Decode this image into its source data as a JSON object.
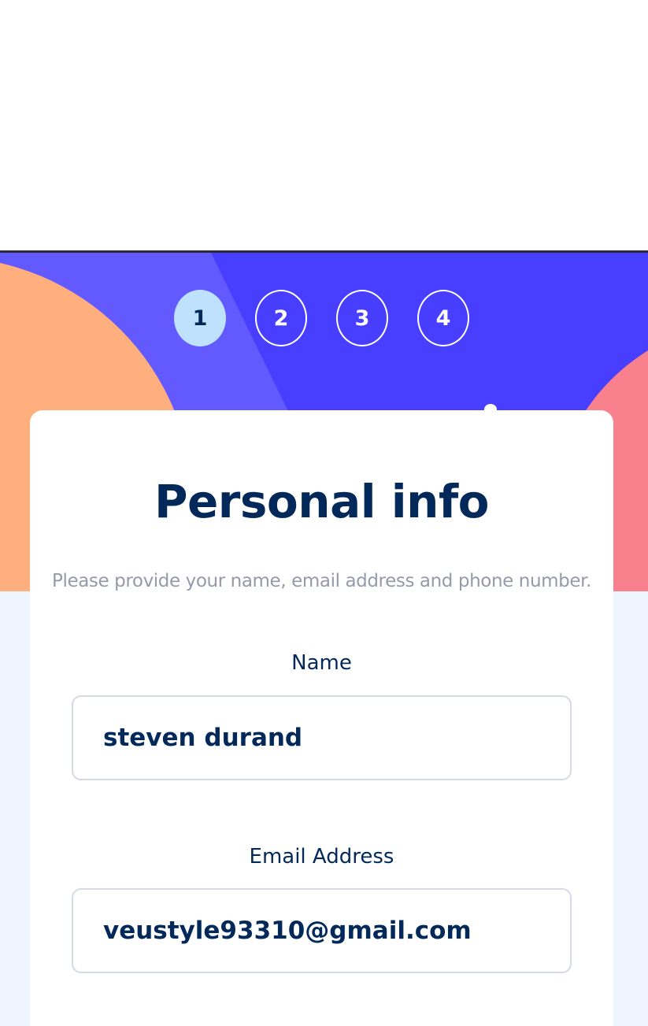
{
  "colors": {
    "primary_purple": "#483eff",
    "light_purple": "#6259ff",
    "orange_shape": "#ffaf7e",
    "pink_shape": "#f9818e",
    "active_step_bg": "#bee2fd",
    "denim_text": "#022959",
    "grey_text": "#9699aa",
    "border": "#d6d9e6",
    "page_bg": "#eff5ff"
  },
  "steps": [
    {
      "number": "1",
      "active": true
    },
    {
      "number": "2",
      "active": false
    },
    {
      "number": "3",
      "active": false
    },
    {
      "number": "4",
      "active": false
    }
  ],
  "card": {
    "title": "Personal info",
    "subtitle": "Please provide your name, email address and phone number."
  },
  "form": {
    "name": {
      "label": "Name",
      "value": "steven durand"
    },
    "email": {
      "label": "Email Address",
      "value": "veustyle93310@gmail.com"
    }
  }
}
